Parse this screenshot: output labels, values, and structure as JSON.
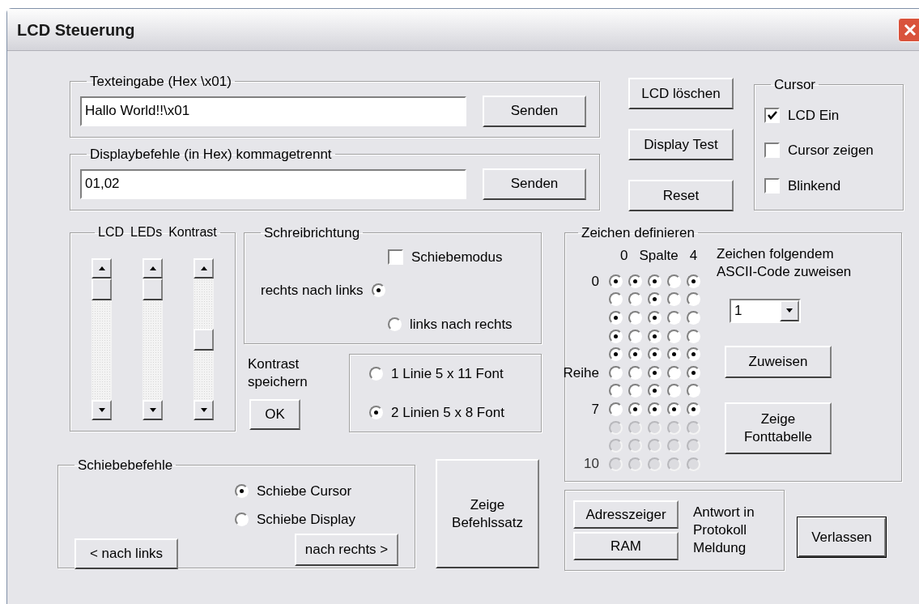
{
  "window": {
    "title": "LCD Steuerung"
  },
  "text_input": {
    "legend": "Texteingabe (Hex \\x01)",
    "value": "Hallo World!!\\x01",
    "button": "Senden"
  },
  "display_commands": {
    "legend": "Displaybefehle (in Hex) kommagetrennt",
    "value": "01,02",
    "button": "Senden"
  },
  "action_buttons": [
    "LCD löschen",
    "Display Test",
    "Reset"
  ],
  "cursor": {
    "legend": "Cursor",
    "options": [
      {
        "label": "LCD Ein",
        "checked": true
      },
      {
        "label": "Cursor zeigen",
        "checked": false
      },
      {
        "label": "Blinkend",
        "checked": false
      }
    ]
  },
  "scrollbars": [
    {
      "label": "LCD"
    },
    {
      "label": "LEDs"
    },
    {
      "label": "Kontrast"
    }
  ],
  "write_direction": {
    "legend": "Schreibrichtung",
    "shift_mode": {
      "label": "Schiebemodus",
      "checked": false
    },
    "options": [
      {
        "label": "rechts nach links",
        "kind": "label_left",
        "selected": true
      },
      {
        "label": "links nach rechts",
        "kind": "label_right",
        "selected": false
      }
    ]
  },
  "contrast_save": {
    "label": "Kontrast speichern",
    "button": "OK"
  },
  "font": {
    "options": [
      {
        "label": "1 Linie 5 x 11 Font",
        "selected": false
      },
      {
        "label": "2 Linien 5 x 8 Font",
        "selected": true
      }
    ]
  },
  "char_define": {
    "legend": "Zeichen definieren",
    "column_header": {
      "first": "0",
      "title": "Spalte",
      "last": "4"
    },
    "rows": [
      {
        "label": "0",
        "disabled": false,
        "cells": [
          {
            "selected": true
          },
          {
            "selected": true
          },
          {
            "selected": true
          },
          {
            "selected": false
          },
          {
            "selected": true
          }
        ]
      },
      {
        "disabled": false,
        "cells": [
          {
            "selected": false
          },
          {
            "selected": false
          },
          {
            "selected": true
          },
          {
            "selected": false
          },
          {
            "selected": false
          }
        ]
      },
      {
        "disabled": false,
        "cells": [
          {
            "selected": true
          },
          {
            "selected": false
          },
          {
            "selected": true
          },
          {
            "selected": false
          },
          {
            "selected": false
          }
        ]
      },
      {
        "disabled": false,
        "cells": [
          {
            "selected": true
          },
          {
            "selected": false
          },
          {
            "selected": true
          },
          {
            "selected": false
          },
          {
            "selected": false
          }
        ]
      },
      {
        "disabled": false,
        "cells": [
          {
            "selected": true
          },
          {
            "selected": true
          },
          {
            "selected": true
          },
          {
            "selected": true
          },
          {
            "selected": true
          }
        ]
      },
      {
        "label": "Reihe",
        "disabled": false,
        "cells": [
          {
            "selected": false
          },
          {
            "selected": false
          },
          {
            "selected": true
          },
          {
            "selected": false
          },
          {
            "selected": true
          }
        ]
      },
      {
        "disabled": false,
        "cells": [
          {
            "selected": false
          },
          {
            "selected": false
          },
          {
            "selected": true
          },
          {
            "selected": false
          },
          {
            "selected": false
          }
        ]
      },
      {
        "label": "7",
        "disabled": false,
        "cells": [
          {
            "selected": false
          },
          {
            "selected": true
          },
          {
            "selected": true
          },
          {
            "selected": true
          },
          {
            "selected": true
          }
        ]
      },
      {
        "disabled": true,
        "cells": [
          {
            "selected": false
          },
          {
            "selected": false
          },
          {
            "selected": false
          },
          {
            "selected": false
          },
          {
            "selected": false
          }
        ]
      },
      {
        "disabled": true,
        "cells": [
          {
            "selected": false
          },
          {
            "selected": false
          },
          {
            "selected": false
          },
          {
            "selected": false
          },
          {
            "selected": false
          }
        ]
      },
      {
        "label": "10",
        "disabled": true,
        "cells": [
          {
            "selected": false
          },
          {
            "selected": false
          },
          {
            "selected": false
          },
          {
            "selected": false
          },
          {
            "selected": false
          }
        ]
      }
    ],
    "assign_label": "Zeichen folgendem ASCII-Code zuweisen",
    "ascii_code": "1",
    "assign_button": "Zuweisen",
    "font_table_button": "Zeige Fonttabelle"
  },
  "shift_commands": {
    "legend": "Schiebebefehle",
    "options": [
      {
        "label": "Schiebe Cursor",
        "selected": true
      },
      {
        "label": "Schiebe Display",
        "selected": false
      }
    ],
    "left_button": "< nach links",
    "right_button": "nach rechts >"
  },
  "show_commands_button": "Zeige Befehlssatz",
  "response": {
    "buttons": [
      "Adresszeiger",
      "RAM"
    ],
    "label": "Antwort in Protokoll Meldung"
  },
  "exit_button": "Verlassen"
}
